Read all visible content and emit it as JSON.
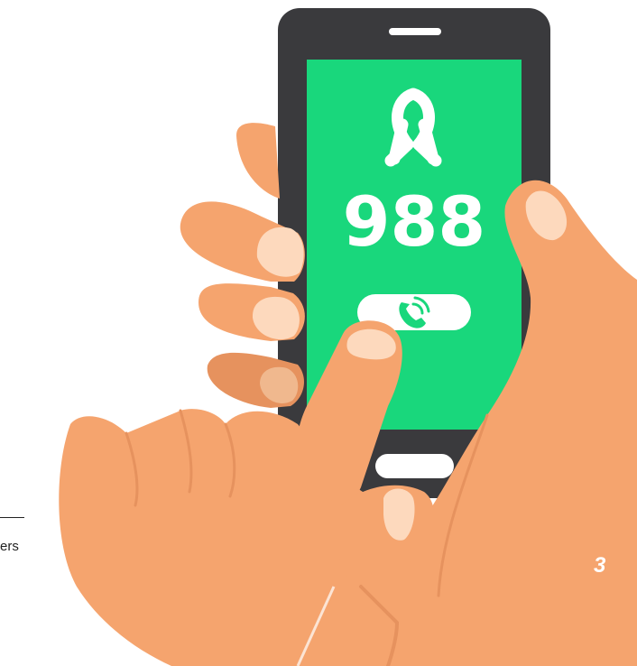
{
  "phone": {
    "number": "988",
    "screen_color": "#19D77C",
    "body_color": "#3A3A3D"
  },
  "icons": {
    "ribbon": "awareness-ribbon-icon",
    "call": "phone-call-icon"
  },
  "colors": {
    "skin": "#F5A46E",
    "skin_shadow": "#E6925E",
    "nail": "#FDD9BD",
    "white": "#FFFFFF"
  },
  "footer": {
    "text": "ers"
  },
  "page": {
    "number": "3"
  }
}
